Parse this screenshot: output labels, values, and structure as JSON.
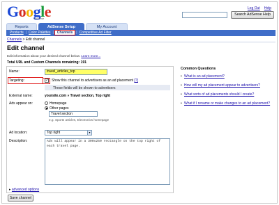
{
  "header": {
    "logo": {
      "l1": "G",
      "l2": "o",
      "l3": "o",
      "l4": "g",
      "l5": "l",
      "l6": "e"
    },
    "logo_sub": "AdSense",
    "help_link": "Help",
    "logout_link": "Log Out",
    "search_value": "",
    "search_button": "Search AdSense Help"
  },
  "tabs": [
    "Reports",
    "AdSense Setup",
    "My Account"
  ],
  "subnav": {
    "items": [
      "Products",
      "Color Palettes",
      "Channels",
      "Competitive Ad Filter"
    ],
    "sep": "|"
  },
  "breadcrumb": {
    "link": "Channels",
    "sep": ">",
    "current": "Edit channel"
  },
  "page": {
    "title": "Edit channel",
    "intro": "Edit information about your desired channel below.",
    "learn_more": "Learn more...",
    "totals": "Total URL and Custom Channels remaining: 191"
  },
  "form": {
    "name_label": "Name:",
    "name_value": "travel_articles_top",
    "targeting_label": "Targeting:",
    "targeting_check": "✓",
    "targeting_text": "Show this channel to advertisers as an ad placement",
    "help_q": "[?]",
    "shown_note": "These fields will be shown to advertisers",
    "external_label": "External name:",
    "external_value": "yoursite.com » Travel section, Top right",
    "appear_label": "Ads appear on:",
    "opt_homepage": "Homepage",
    "opt_other": "Other pages",
    "other_value": "Travel section",
    "other_hint": "e.g. Sports articles, Electronics homepage",
    "location_label": "Ad location:",
    "location_value": "Top right",
    "description_label": "Description:",
    "description_value": "Ads will appear in a 300x250 rectangle on the top right of each travel page.",
    "advanced": "advanced options",
    "advanced_arrow": "▸",
    "save": "Save channel"
  },
  "questions": {
    "title": "Common Questions",
    "bullet": "•",
    "items": [
      "What is an ad placement?",
      "How will my ad placement appear to advertisers?",
      "What sorts of ad placements should I create?",
      "What if I rename or make changes to an ad placement?"
    ]
  },
  "colors": {
    "accent": "#3f6dc8",
    "tab_inactive": "#d5e1f5",
    "highlight": "#ffff66",
    "annotation_red": "#e02020",
    "link": "#1a0dab"
  }
}
